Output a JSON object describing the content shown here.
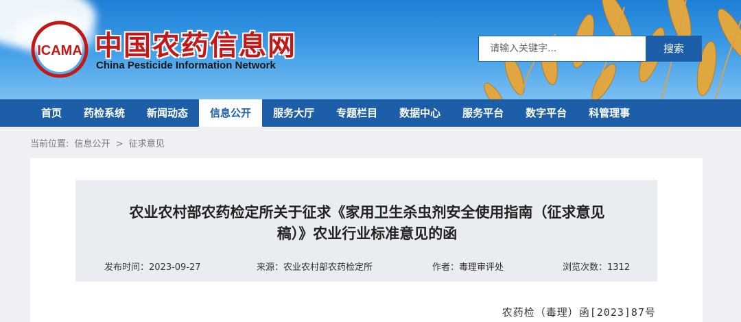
{
  "header": {
    "site_title": "中国农药信息网",
    "site_subtitle": "China Pesticide Information Network",
    "logo_text": "ICAMA",
    "search": {
      "placeholder": "请输入关键字...",
      "button_label": "搜索"
    }
  },
  "nav": {
    "items": [
      {
        "label": "首页",
        "active": false
      },
      {
        "label": "药检系统",
        "active": false
      },
      {
        "label": "新闻动态",
        "active": false
      },
      {
        "label": "信息公开",
        "active": true
      },
      {
        "label": "服务大厅",
        "active": false
      },
      {
        "label": "专题栏目",
        "active": false
      },
      {
        "label": "数据中心",
        "active": false
      },
      {
        "label": "服务平台",
        "active": false
      },
      {
        "label": "数字平台",
        "active": false
      },
      {
        "label": "科管理事",
        "active": false
      }
    ]
  },
  "breadcrumb": {
    "prefix": "当前位置:",
    "items": [
      "信息公开",
      "征求意见"
    ],
    "separator": ">"
  },
  "article": {
    "title_line1": "农业农村部农药检定所关于征求《家用卫生杀虫剂安全使用指南（征求意见",
    "title_line2": "稿）》农业行业标准意见的函",
    "publish_time": "发布时间：2023-09-27",
    "source": "来源：农业农村部农药检定所",
    "author": "作者：毒理审评处",
    "views": "浏览次数：1312",
    "doc_number": "农药检（毒理）函[2023]87号"
  },
  "colors": {
    "nav_bg": "#1d5ea9",
    "title_red": "#c41717",
    "accent_blue": "#1c5fa8"
  }
}
